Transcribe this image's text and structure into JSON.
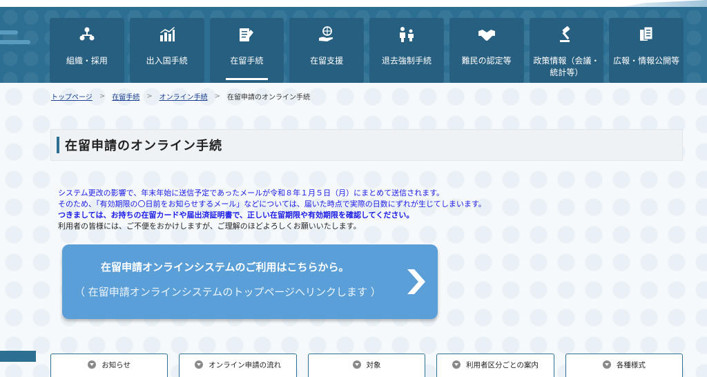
{
  "nav": {
    "items": [
      {
        "label": "組織・採用",
        "icon": "organization-icon"
      },
      {
        "label": "出入国手続",
        "icon": "chart-icon"
      },
      {
        "label": "在留手続",
        "icon": "document-pen-icon",
        "active": true
      },
      {
        "label": "在留支援",
        "icon": "globe-hand-icon"
      },
      {
        "label": "退去強制手続",
        "icon": "people-icon"
      },
      {
        "label": "難民の認定等",
        "icon": "handshake-icon"
      },
      {
        "label": "政策情報（会議・統計等）",
        "icon": "gavel-icon"
      },
      {
        "label": "広報・情報公開等",
        "icon": "documents-icon"
      }
    ]
  },
  "breadcrumb": {
    "items": [
      "トップページ",
      "在留手続",
      "オンライン手続"
    ],
    "current": "在留申請のオンライン手続"
  },
  "page": {
    "title": "在留申請のオンライン手続"
  },
  "notice": {
    "line1": "システム更改の影響で、年末年始に送信予定であったメールが令和８年１月５日（月）にまとめて送信されます。",
    "line2": "そのため、「有効期限の〇日前をお知らせするメール」などについては、届いた時点で実際の日数にずれが生じてしまいます。",
    "line3": "つきましては、お持ちの在留カードや届出済証明書で、正しい在留期限や有効期限を確認してください。",
    "line4": "利用者の皆様には、ご不便をおかけしますが、ご理解のほどよろしくお願いいたします。"
  },
  "online_link": {
    "main": "在留申請オンラインシステムのご利用はこちらから。",
    "sub": "（ 在留申請オンラインシステムのトップページへリンクします ）"
  },
  "bottom_tabs": [
    {
      "label": "お知らせ"
    },
    {
      "label": "オンライン申請の流れ"
    },
    {
      "label": "対象"
    },
    {
      "label": "利用者区分ごとの案内"
    },
    {
      "label": "各種様式"
    }
  ],
  "colors": {
    "header": "#2d6f93",
    "nav_item": "#275f80",
    "link_button": "#5b9fd8",
    "notice_text": "#1a1ae6"
  }
}
